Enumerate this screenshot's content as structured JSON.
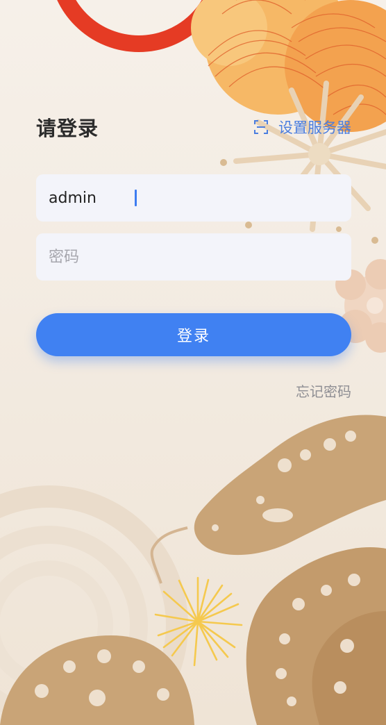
{
  "login": {
    "title": "请登录",
    "server_link": "设置服务器",
    "username_value": "admin",
    "password_placeholder": "密码",
    "login_button": "登录",
    "forgot_password": "忘记密码"
  },
  "icons": {
    "server_link": "scan-icon"
  },
  "colors": {
    "accent": "#4081f2",
    "link": "#4a7ddf",
    "field_bg": "#f3f4fa",
    "lantern_red": "#e53b24",
    "papercut_gold": "#c9a477"
  }
}
